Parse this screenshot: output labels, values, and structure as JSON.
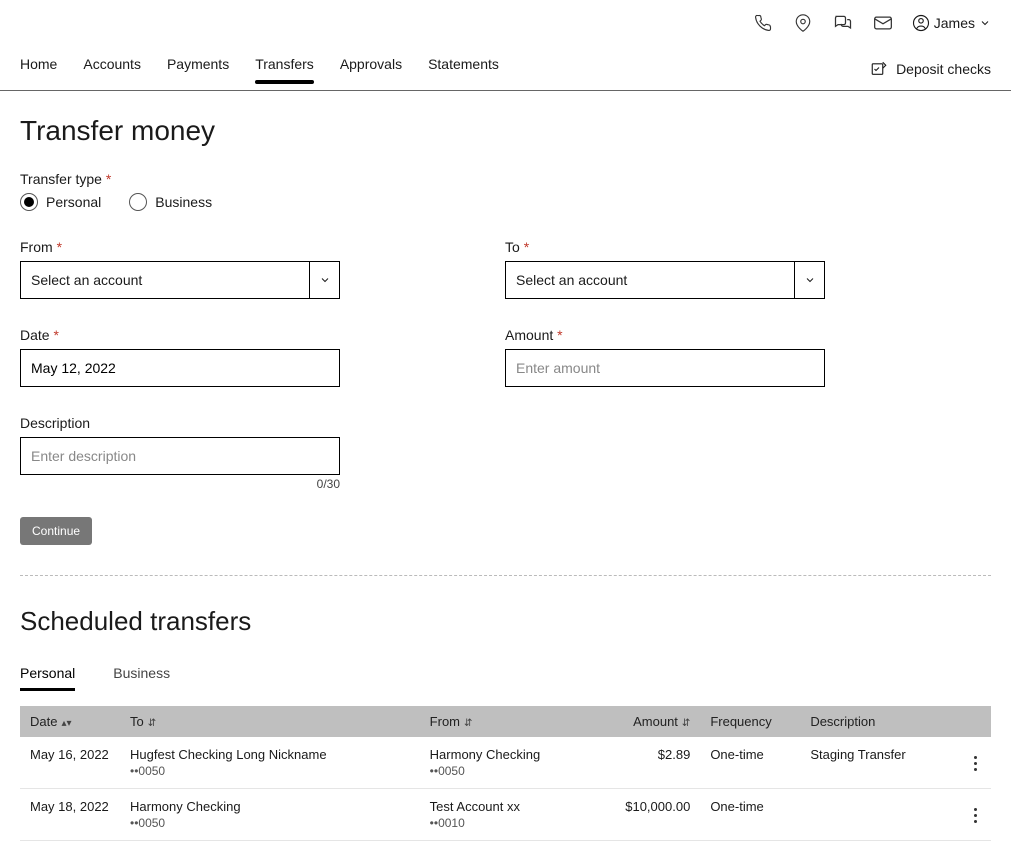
{
  "header": {
    "user_name": "James"
  },
  "nav": {
    "items": [
      "Home",
      "Accounts",
      "Payments",
      "Transfers",
      "Approvals",
      "Statements"
    ],
    "active_index": 3,
    "deposit_label": "Deposit checks"
  },
  "page": {
    "title": "Transfer money"
  },
  "form": {
    "transfer_type_label": "Transfer type",
    "radio_personal": "Personal",
    "radio_business": "Business",
    "from_label": "From",
    "to_label": "To",
    "from_placeholder": "Select an account",
    "to_placeholder": "Select an account",
    "date_label": "Date",
    "date_value": "May 12, 2022",
    "amount_label": "Amount",
    "amount_placeholder": "Enter amount",
    "description_label": "Description",
    "description_placeholder": "Enter description",
    "description_counter": "0/30",
    "continue_label": "Continue"
  },
  "scheduled": {
    "title": "Scheduled transfers",
    "tabs": [
      "Personal",
      "Business"
    ],
    "active_tab": 0,
    "columns": {
      "date": "Date",
      "to": "To",
      "from": "From",
      "amount": "Amount",
      "frequency": "Frequency",
      "description": "Description"
    },
    "rows": [
      {
        "date": "May 16, 2022",
        "to_name": "Hugfest Checking Long Nickname",
        "to_mask": "••0050",
        "from_name": "Harmony Checking",
        "from_mask": "••0050",
        "amount": "$2.89",
        "frequency": "One-time",
        "description": "Staging Transfer"
      },
      {
        "date": "May 18, 2022",
        "to_name": "Harmony Checking",
        "to_mask": "••0050",
        "from_name": "Test Account xx",
        "from_mask": "••0010",
        "amount": "$10,000.00",
        "frequency": "One-time",
        "description": ""
      }
    ]
  }
}
